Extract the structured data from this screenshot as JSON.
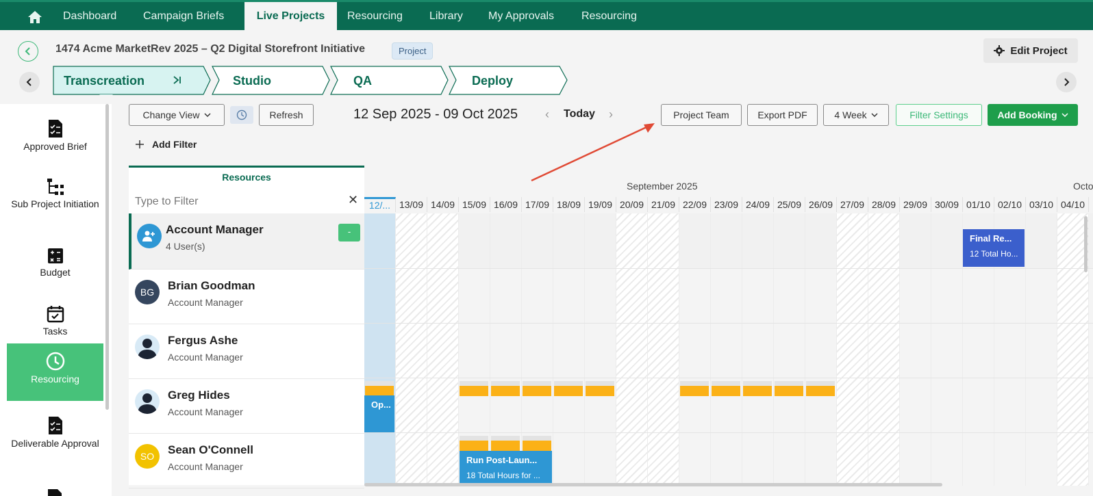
{
  "nav": {
    "items": [
      "Dashboard",
      "Campaign Briefs",
      "Live Projects",
      "Resourcing",
      "Library",
      "My Approvals",
      "Resourcing"
    ],
    "active": "Live Projects"
  },
  "project": {
    "title": "1474 Acme MarketRev 2025 – Q2 Digital Storefront Initiative",
    "badge": "Project",
    "edit_label": "Edit Project"
  },
  "stages": [
    "Transcreation",
    "Studio",
    "QA",
    "Deploy"
  ],
  "sidebar": {
    "items": [
      "Approved Brief",
      "Sub Project Initiation",
      "Budget",
      "Tasks",
      "Resourcing",
      "Deliverable Approval"
    ],
    "active": "Resourcing"
  },
  "toolbar": {
    "change_view": "Change View",
    "refresh": "Refresh",
    "date_range": "12 Sep 2025 - 09 Oct 2025",
    "today": "Today",
    "project_team": "Project Team",
    "export_pdf": "Export PDF",
    "period": "4 Week",
    "filter_settings": "Filter Settings",
    "add_booking": "Add Booking",
    "add_filter": "Add Filter"
  },
  "resources": {
    "tab": "Resources",
    "filter_placeholder": "Type to Filter",
    "collapse_label": "-",
    "group": {
      "name": "Account Manager",
      "count": "4 User(s)"
    },
    "people": [
      {
        "initials": "BG",
        "name": "Brian Goodman",
        "role": "Account Manager"
      },
      {
        "initials": "",
        "name": "Fergus Ashe",
        "role": "Account Manager"
      },
      {
        "initials": "",
        "name": "Greg Hides",
        "role": "Account Manager"
      },
      {
        "initials": "SO",
        "name": "Sean O'Connell",
        "role": "Account Manager"
      }
    ]
  },
  "calendar": {
    "months": [
      "September 2025",
      "Octo"
    ],
    "days": [
      "12/...",
      "13/09",
      "14/09",
      "15/09",
      "16/09",
      "17/09",
      "18/09",
      "19/09",
      "20/09",
      "21/09",
      "22/09",
      "23/09",
      "24/09",
      "25/09",
      "26/09",
      "27/09",
      "28/09",
      "29/09",
      "30/09",
      "01/10",
      "02/10",
      "03/10",
      "04/10"
    ],
    "bookings": [
      {
        "title": "Final Re...",
        "sub": "12 Total Ho..."
      },
      {
        "title": "Op...",
        "sub": ""
      },
      {
        "title": "Run Post-Laun...",
        "sub": "18 Total Hours for ..."
      }
    ]
  },
  "colors": {
    "primary": "#0a6b52",
    "accent": "#3cb878",
    "booking_blue": "#3b5fcc",
    "booking_light": "#2e97d4",
    "bar": "#fbb117"
  }
}
